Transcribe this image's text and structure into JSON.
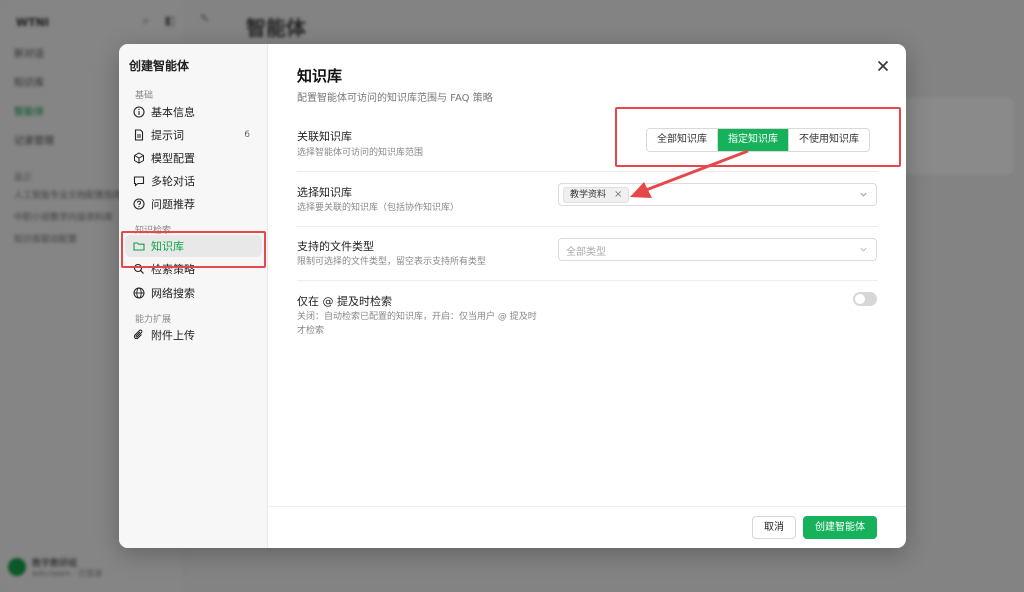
{
  "background": {
    "logo": "WTNI",
    "logo_icons": "⌕ ◧",
    "nav": [
      "新对话",
      "知识库",
      "智能体",
      "记录管理"
    ],
    "recent_title": "最近",
    "recent": [
      "人工智能专业文档配置指南",
      "中职小班教学内容资料库",
      "知识库联动配置"
    ],
    "page_title": "智能体",
    "top_edit_icon": "✎",
    "user_name": "教学教研组",
    "user_sub": "edu-team · 已登录"
  },
  "modal": {
    "side_title": "创建智能体",
    "groups": {
      "basic": "基础",
      "knowledge": "知识检索",
      "ext": "能力扩展"
    },
    "items": [
      {
        "label": "基本信息",
        "icon": "info-icon"
      },
      {
        "label": "提示词",
        "icon": "document-icon",
        "count": "6"
      },
      {
        "label": "模型配置",
        "icon": "cube-icon"
      },
      {
        "label": "多轮对话",
        "icon": "chat-icon"
      },
      {
        "label": "问题推荐",
        "icon": "question-icon"
      },
      {
        "label": "知识库",
        "icon": "folder-icon",
        "active": true
      },
      {
        "label": "检索策略",
        "icon": "search-icon"
      },
      {
        "label": "网络搜索",
        "icon": "globe-icon"
      },
      {
        "label": "附件上传",
        "icon": "paperclip-icon"
      }
    ],
    "title": "知识库",
    "subtitle": "配置智能体可访问的知识库范围与 FAQ 策略",
    "rows": {
      "link": {
        "label": "关联知识库",
        "desc": "选择智能体可访问的知识库范围",
        "options": [
          "全部知识库",
          "指定知识库",
          "不使用知识库"
        ],
        "selected": "指定知识库"
      },
      "select": {
        "label": "选择知识库",
        "desc": "选择要关联的知识库（包括协作知识库）",
        "tag": "教学资料",
        "tag_remove": "×"
      },
      "filetype": {
        "label": "支持的文件类型",
        "desc": "限制可选择的文件类型，留空表示支持所有类型",
        "placeholder": "全部类型"
      },
      "mention": {
        "label": "仅在 @ 提及时检索",
        "desc": "关闭：自动检索已配置的知识库，开启：仅当用户 @ 提及时才检索",
        "enabled": false
      }
    },
    "footer": {
      "cancel": "取消",
      "create": "创建智能体"
    }
  },
  "colors": {
    "accent": "#16b25b",
    "annotation": "#e4484b"
  }
}
